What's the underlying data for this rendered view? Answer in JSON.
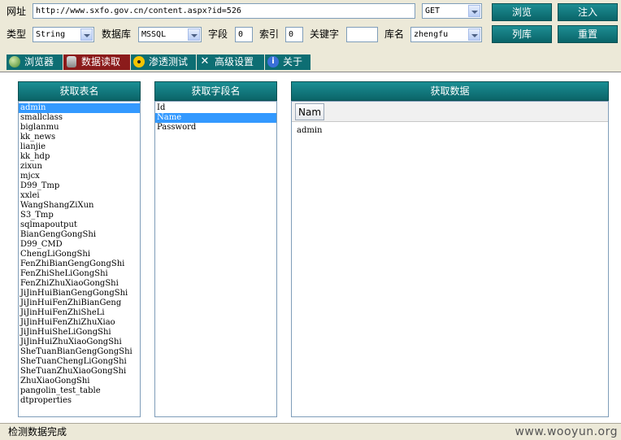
{
  "toolbar": {
    "url_label": "网址",
    "url_value": "http://www.sxfo.gov.cn/content.aspx?id=526",
    "method_value": "GET",
    "browse_button": "浏览",
    "inject_button": "注入",
    "type_label": "类型",
    "type_value": "String",
    "db_label": "数据库",
    "db_value": "MSSQL",
    "field_label": "字段",
    "field_value": "0",
    "index_label": "索引",
    "index_value": "0",
    "keyword_label": "关键字",
    "keyword_value": "",
    "dbname_label": "库名",
    "dbname_value": "zhengfu",
    "list_db_button": "列库",
    "reset_button": "重置"
  },
  "tabs": [
    {
      "label": "浏览器",
      "icon": "globe-icon"
    },
    {
      "label": "数据读取",
      "icon": "database-icon"
    },
    {
      "label": "渗透测试",
      "icon": "radiation-icon"
    },
    {
      "label": "高级设置",
      "icon": "tools-icon"
    },
    {
      "label": "关于",
      "icon": "info-icon"
    }
  ],
  "tables_panel": {
    "title": "获取表名",
    "items": [
      "admin",
      "smallclass",
      "biglanmu",
      "kk_news",
      "lianjie",
      "kk_hdp",
      "zixun",
      "mjcx",
      "D99_Tmp",
      "xxlei",
      "WangShangZiXun",
      "S3_Tmp",
      "sqlmapoutput",
      "BianGengGongShi",
      "D99_CMD",
      "ChengLiGongShi",
      "FenZhiBianGengGongShi",
      "FenZhiSheLiGongShi",
      "FenZhiZhuXiaoGongShi",
      "JiJinHuiBianGengGongShi",
      "JiJinHuiFenZhiBianGeng",
      "JiJinHuiFenZhiSheLi",
      "JiJinHuiFenZhiZhuXiao",
      "JiJinHuiSheLiGongShi",
      "JiJinHuiZhuXiaoGongShi",
      "SheTuanBianGengGongShi",
      "SheTuanChengLiGongShi",
      "SheTuanZhuXiaoGongShi",
      "ZhuXiaoGongShi",
      "pangolin_test_table",
      "dtproperties"
    ],
    "selected_index": 0
  },
  "fields_panel": {
    "title": "获取字段名",
    "items": [
      "Id",
      "Name",
      "Password"
    ],
    "selected_index": 1
  },
  "data_panel": {
    "title": "获取数据",
    "column_header": "Nam",
    "rows": [
      "admin"
    ]
  },
  "status": {
    "text": "检测数据完成",
    "watermark": "www.wooyun.org"
  },
  "colors": {
    "teal": "#0d6e73",
    "active_tab": "#8b1b1b",
    "selection": "#3399ff"
  }
}
